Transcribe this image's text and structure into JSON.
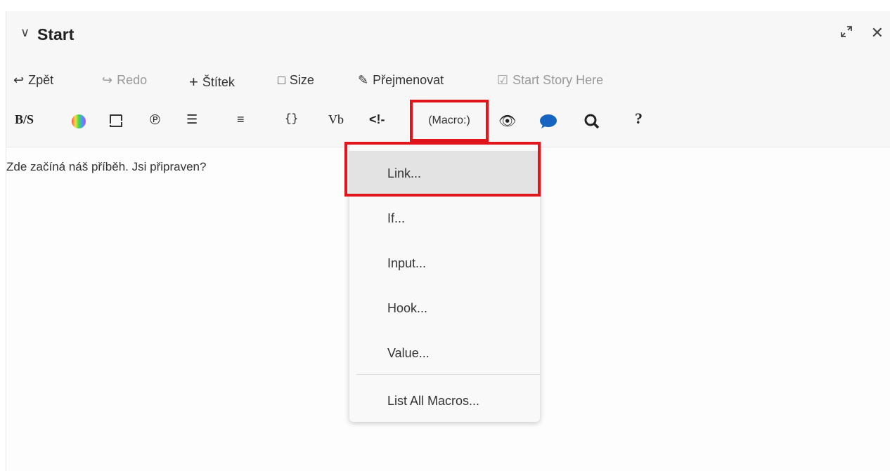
{
  "dialog": {
    "title": "Start",
    "icons": {
      "collapse": "chevron-down-icon",
      "maximize": "maximize-icon",
      "close": "close-icon"
    }
  },
  "toolbar1": {
    "undo_label": "Zpět",
    "redo_label": "Redo",
    "tag_label": "Štítek",
    "size_label": "Size",
    "rename_label": "Přejmenovat",
    "start_story_label": "Start Story Here"
  },
  "toolbar2": {
    "bold_strike_label": "B/S",
    "vb_label": "Vb",
    "braces_label": "{}",
    "comment_label": "<!-",
    "macro_label": "(Macro:)",
    "help_label": "?"
  },
  "passage": {
    "text": "Zde začíná náš příběh. Jsi připraven?"
  },
  "macro_menu": {
    "items": [
      "Link...",
      "If...",
      "Input...",
      "Hook...",
      "Value..."
    ],
    "list_all_label": "List All Macros..."
  },
  "colors": {
    "highlight_red": "#e2141c",
    "accent_blue": "#1565c0"
  }
}
